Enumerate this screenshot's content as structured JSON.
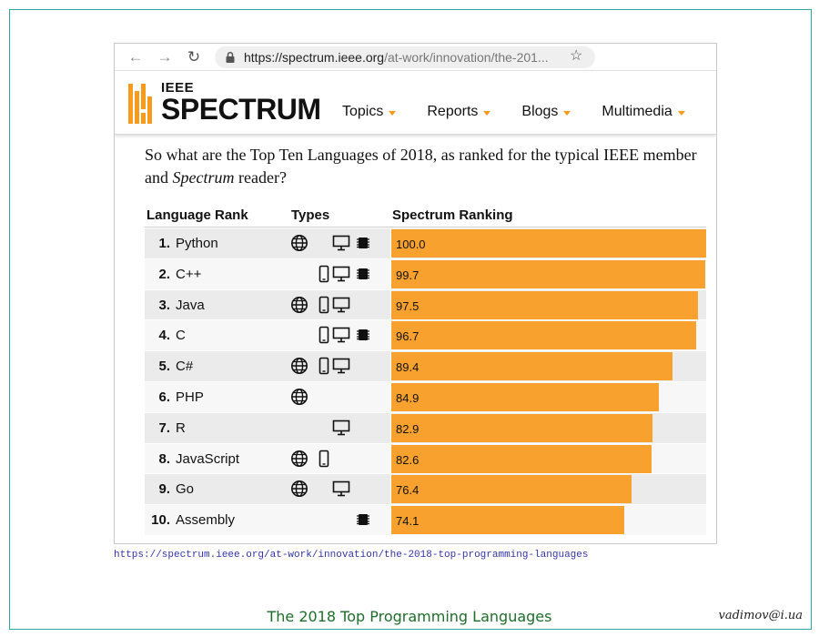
{
  "browser": {
    "url_host": "https://spectrum.ieee.org",
    "url_path": "/at-work/innovation/the-201..."
  },
  "site": {
    "logo_top": "IEEE",
    "logo_bottom": "SPECTRUM",
    "menu": [
      "Topics",
      "Reports",
      "Blogs",
      "Multimedia"
    ],
    "accent_color": "#f79b1c"
  },
  "article": {
    "intro_before": "So what are the Top Ten Languages of 2018, as ranked for the typical IEEE member and ",
    "intro_italic": "Spectrum",
    "intro_after": " reader?"
  },
  "table": {
    "headers": [
      "Language Rank",
      "Types",
      "Spectrum Ranking"
    ],
    "rows": [
      {
        "rank": "1.",
        "name": "Python",
        "types": [
          "web",
          "desktop",
          "embedded"
        ],
        "score": "100.0"
      },
      {
        "rank": "2.",
        "name": "C++",
        "types": [
          "mobile",
          "desktop",
          "embedded"
        ],
        "score": "99.7"
      },
      {
        "rank": "3.",
        "name": "Java",
        "types": [
          "web",
          "mobile",
          "desktop"
        ],
        "score": "97.5"
      },
      {
        "rank": "4.",
        "name": "C",
        "types": [
          "mobile",
          "desktop",
          "embedded"
        ],
        "score": "96.7"
      },
      {
        "rank": "5.",
        "name": "C#",
        "types": [
          "web",
          "mobile",
          "desktop"
        ],
        "score": "89.4"
      },
      {
        "rank": "6.",
        "name": "PHP",
        "types": [
          "web"
        ],
        "score": "84.9"
      },
      {
        "rank": "7.",
        "name": "R",
        "types": [
          "desktop"
        ],
        "score": "82.9"
      },
      {
        "rank": "8.",
        "name": "JavaScript",
        "types": [
          "web",
          "mobile"
        ],
        "score": "82.6"
      },
      {
        "rank": "9.",
        "name": "Go",
        "types": [
          "web",
          "desktop"
        ],
        "score": "76.4"
      },
      {
        "rank": "10.",
        "name": "Assembly",
        "types": [
          "embedded"
        ],
        "score": "74.1"
      }
    ],
    "bar_color": "#f9a12e"
  },
  "footer": {
    "source_url": "https://spectrum.ieee.org/at-work/innovation/the-2018-top-programming-languages",
    "title": "The 2018 Top Programming Languages",
    "author": "vadimov@i.ua"
  }
}
